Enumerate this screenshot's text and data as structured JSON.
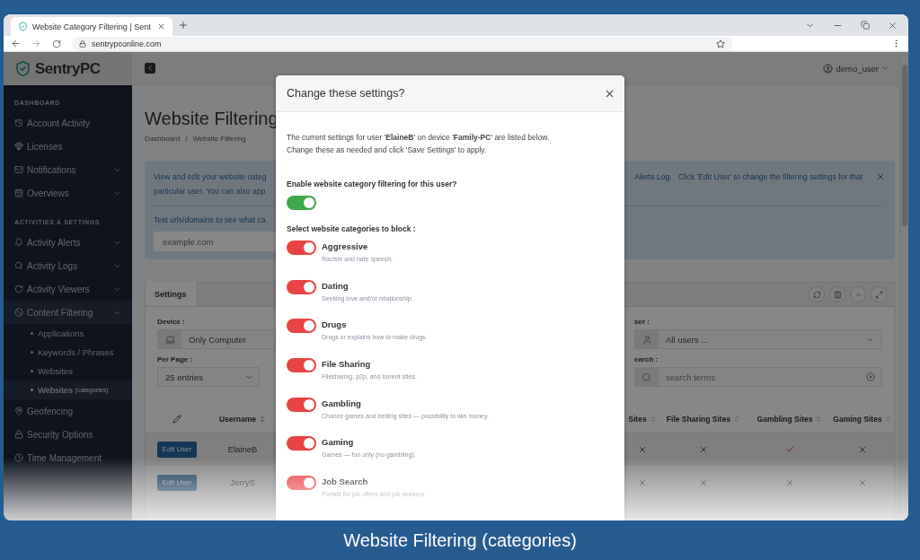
{
  "browser": {
    "tab_title": "Website Category Filtering | Sent",
    "url": "sentrypconline.com"
  },
  "app": {
    "logo": "SentryPC",
    "user": "demo_user"
  },
  "sidebar": {
    "sections": [
      {
        "heading": "DASHBOARD",
        "items": [
          {
            "label": "Account Activity",
            "selected": false
          },
          {
            "label": "Licenses",
            "selected": false
          },
          {
            "label": "Notifications",
            "selected": false,
            "expanded": false
          },
          {
            "label": "Overviews",
            "selected": false,
            "expanded": false
          }
        ]
      },
      {
        "heading": "ACTIVITIES & SETTINGS",
        "items": [
          {
            "label": "Activity Alerts",
            "selected": false,
            "expanded": false
          },
          {
            "label": "Activity Logs",
            "selected": false,
            "expanded": false
          },
          {
            "label": "Activity Viewers",
            "selected": false,
            "expanded": false
          },
          {
            "label": "Content Filtering",
            "selected": false,
            "expanded": true,
            "children": [
              {
                "label": "Applications",
                "selected": false
              },
              {
                "label": "Keywords / Phrases",
                "selected": false
              },
              {
                "label": "Websites",
                "selected": false
              },
              {
                "label": "Websites",
                "note": "(categories)",
                "selected": true
              }
            ]
          },
          {
            "label": "Geofencing",
            "selected": false
          },
          {
            "label": "Security Options",
            "selected": false
          },
          {
            "label": "Time Management",
            "selected": false
          }
        ]
      }
    ]
  },
  "page": {
    "title": "Website Filtering",
    "breadcrumb": [
      "Dashboard",
      "Website Filtering"
    ],
    "breadcrumb_separator": "/"
  },
  "notice": {
    "line_1_left": "View and edit your website categ",
    "link": "Alerts Log.",
    "line_1_right": "Click 'Edit User' to change the filtering settings for that",
    "line_2_left": "particular user.  You can also app",
    "test_label": "Test urls/domains to see what ca",
    "test_placeholder": "example.com"
  },
  "card": {
    "tabs": [
      {
        "label": "Settings",
        "selected": true
      }
    ],
    "filters_left": [
      {
        "label": "Device :",
        "value": "Only Computer",
        "kind": "device"
      },
      {
        "label": "Per Page :",
        "value": "25 entries",
        "kind": "select"
      }
    ],
    "filters_right": [
      {
        "label": "ser :",
        "value": "All users ...",
        "kind": "user"
      },
      {
        "label": "earch :",
        "placeholder": "search terms",
        "kind": "search"
      }
    ],
    "table": {
      "columns": [
        "Username",
        "Sites",
        "File Sharing Sites",
        "Gambling Sites",
        "Gaming Sites"
      ],
      "rows": [
        {
          "action": "Edit User",
          "username": "ElaineB",
          "flags": [
            false,
            false,
            true,
            false
          ]
        },
        {
          "action": "Edit User",
          "username": "JerryS",
          "flags": [
            false,
            false,
            false,
            false
          ]
        }
      ]
    }
  },
  "modal": {
    "title": "Change these settings?",
    "intro": "The current settings for user '**ElaineB**' on device '**Family-PC**' are listed below.\nChange these as needed and click 'Save Settings' to apply.",
    "enable_label": "Enable website category filtering for this user?",
    "enabled": true,
    "categories_label": "Select website categories to block :",
    "categories": [
      {
        "name": "Aggressive",
        "description": "Racism and hate speech.",
        "on": true
      },
      {
        "name": "Dating",
        "description": "Seeking love and/or relationship.",
        "on": true
      },
      {
        "name": "Drugs",
        "description": "Drugs or explains how to make drugs.",
        "on": true
      },
      {
        "name": "File Sharing",
        "description": "Filesharing, p2p, and torrent sites.",
        "on": true
      },
      {
        "name": "Gambling",
        "description": "Chance games and betting sites — possibility to win money.",
        "on": true
      },
      {
        "name": "Gaming",
        "description": "Games — fun only (no gambling).",
        "on": true
      },
      {
        "name": "Job Search",
        "description": "Portals for job offers and job seekers.",
        "on": true
      }
    ]
  },
  "caption": "Website Filtering (categories)"
}
